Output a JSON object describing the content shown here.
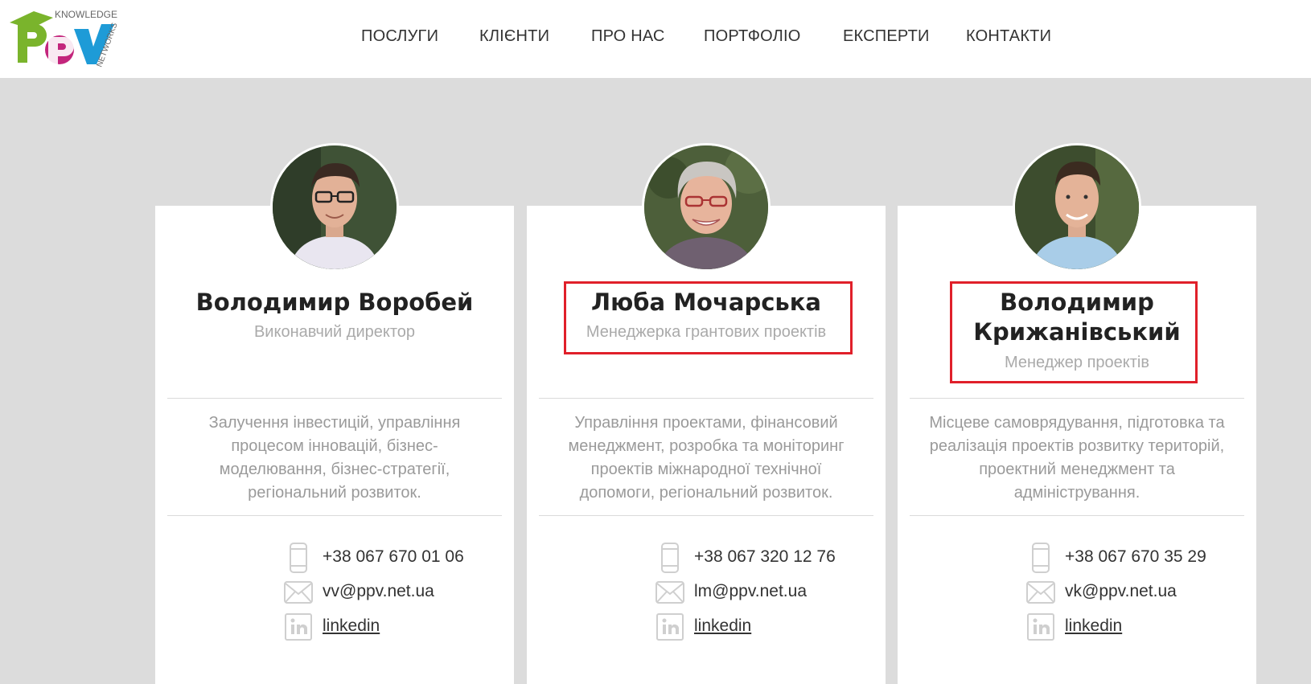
{
  "brand": {
    "logo_letters": "PPV",
    "logo_top_text": "KNOWLEDGE",
    "logo_side_text": "NETWORKS",
    "colors": {
      "green": "#7ab42c",
      "magenta": "#c3257c",
      "blue": "#1e9bd7"
    }
  },
  "nav": {
    "items": [
      {
        "label": "ПОСЛУГИ"
      },
      {
        "label": "КЛІЄНТИ"
      },
      {
        "label": "ПРО НАС"
      },
      {
        "label": "ПОРТФОЛІО"
      },
      {
        "label": "ЕКСПЕРТИ"
      },
      {
        "label": "КОНТАКТИ"
      }
    ]
  },
  "experts": [
    {
      "name": "Володимир Воробей",
      "name_lines": [
        "Володимир Воробей"
      ],
      "role": "Виконавчий директор",
      "description_lines": [
        "Залучення інвестицій, управління",
        "процесом інновацій, бізнес-",
        "моделювання, бізнес-стратегії,",
        "регіональний розвиток."
      ],
      "phone": "+38 067 670 01 06",
      "email": "vv@ppv.net.ua",
      "linkedin": "linkedin",
      "highlighted": false
    },
    {
      "name": "Люба Мочарська",
      "name_lines": [
        "Люба Мочарська"
      ],
      "role": "Менеджерка грантових проектів",
      "description_lines": [
        "Управління проектами, фінансовий",
        "менеджмент, розробка та моніторинг",
        "проектів міжнародної технічної",
        "допомоги, регіональний розвиток."
      ],
      "phone": "+38 067 320 12 76",
      "email": "lm@ppv.net.ua",
      "linkedin": "linkedin",
      "highlighted": true
    },
    {
      "name": "Володимир Крижанівський",
      "name_lines": [
        "Володимир",
        "Крижанівський"
      ],
      "role": "Менеджер проектів",
      "description_lines": [
        "Місцеве самоврядування, підготовка та",
        "реалізація проектів розвитку територій,",
        "проектний менеджмент та",
        "адміністрування."
      ],
      "phone": "+38 067 670 35 29",
      "email": "vk@ppv.net.ua",
      "linkedin": "linkedin",
      "highlighted": true
    }
  ],
  "icons": {
    "phone": "phone-icon",
    "email": "email-icon",
    "linkedin": "linkedin-icon"
  },
  "highlight_color": "#e0202a"
}
